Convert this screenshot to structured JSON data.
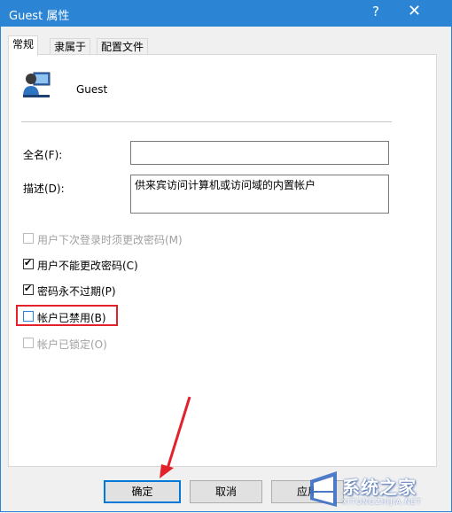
{
  "window": {
    "title": "Guest 属性",
    "help": "?",
    "close": "✕"
  },
  "tabs": [
    {
      "label": "常规",
      "active": true
    },
    {
      "label": "隶属于",
      "active": false
    },
    {
      "label": "配置文件",
      "active": false
    }
  ],
  "user": {
    "icon": "user-account-icon",
    "name": "Guest"
  },
  "fields": {
    "fullname": {
      "label": "全名(F):",
      "value": ""
    },
    "description": {
      "label": "描述(D):",
      "value": "供来宾访问计算机或访问域的内置帐户"
    }
  },
  "checkboxes": [
    {
      "label": "用户下次登录时须更改密码(M)",
      "checked": false,
      "disabled": true
    },
    {
      "label": "用户不能更改密码(C)",
      "checked": true,
      "disabled": false
    },
    {
      "label": "密码永不过期(P)",
      "checked": true,
      "disabled": false
    },
    {
      "label": "帐户已禁用(B)",
      "checked": false,
      "disabled": false
    },
    {
      "label": "帐户已锁定(O)",
      "checked": false,
      "disabled": true
    }
  ],
  "buttons": {
    "ok": "确定",
    "cancel": "取消",
    "apply": "应用"
  },
  "watermark": {
    "text": "系统之家",
    "sub": "XITONGZHIJIA.NET"
  },
  "colors": {
    "titlebar": "#2b85d4",
    "highlight": "#e3212b",
    "arrow": "#e3212b",
    "primary_border": "#0078d7"
  }
}
